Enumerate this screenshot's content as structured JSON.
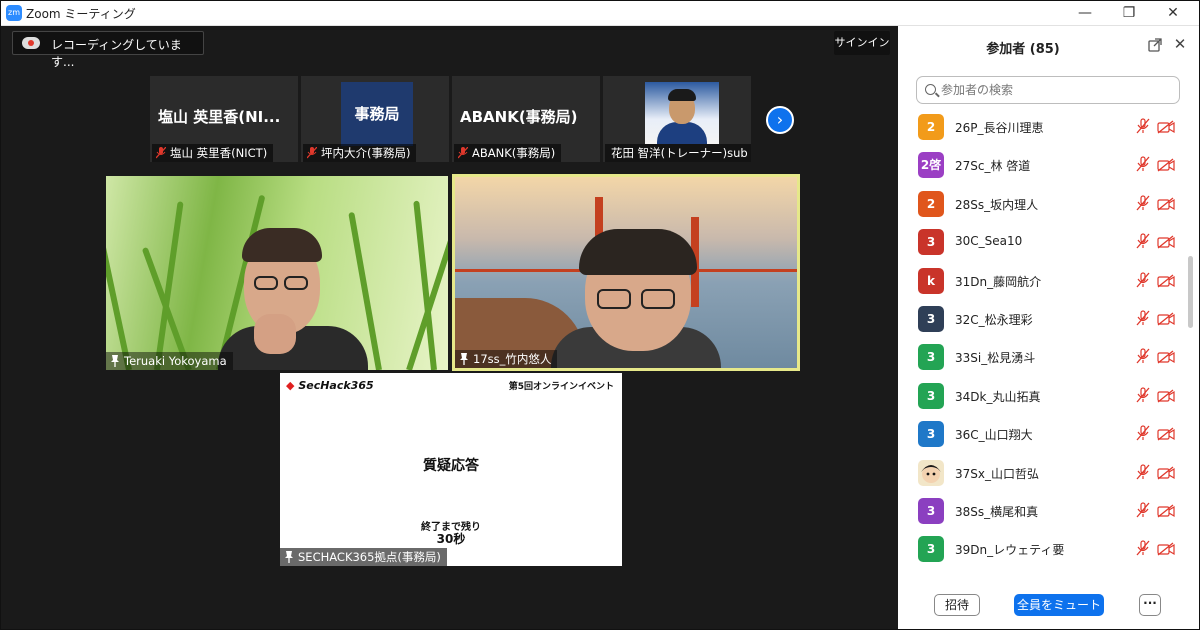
{
  "window": {
    "app_icon_text": "zm",
    "title": "Zoom ミーティング",
    "minimize": "—",
    "maximize": "❐",
    "close": "✕"
  },
  "meeting": {
    "recording_text": "レコーディングしています...",
    "signin_label": "サインイン",
    "top_strip": [
      {
        "big_text": "塩山 英里香(NI...",
        "label": "塩山 英里香(NICT)"
      },
      {
        "big_text": "事務局",
        "label": "坪内大介(事務局)"
      },
      {
        "big_text": "ABANK(事務局)",
        "label": "ABANK(事務局)"
      },
      {
        "big_text": "",
        "label": "花田 智洋(トレーナー)sub"
      }
    ],
    "next_icon": "›",
    "video_left_label": "Teruaki Yokoyama",
    "video_right_label": "17ss_竹内悠人",
    "slide": {
      "logo": "SecHack365",
      "event": "第5回オンラインイベント",
      "title": "質疑応答",
      "remaining": "終了まで残り",
      "seconds": "30秒",
      "label": "SECHACK365拠点(事務局)"
    }
  },
  "panel": {
    "title": "参加者 (85)",
    "search_placeholder": "参加者の検索",
    "close_icon": "✕",
    "participants": [
      {
        "avatar": "2",
        "color": "#f29b1a",
        "name": "26P_長谷川理恵"
      },
      {
        "avatar": "2啓",
        "color": "#9b3fc4",
        "name": "27Sc_林 啓道"
      },
      {
        "avatar": "2",
        "color": "#e0561c",
        "name": "28Ss_坂内理人"
      },
      {
        "avatar": "3",
        "color": "#c9342a",
        "name": "30C_Sea10"
      },
      {
        "avatar": "k",
        "color": "#c9342a",
        "name": "31Dn_藤岡航介"
      },
      {
        "avatar": "3",
        "color": "#2f3f57",
        "name": "32C_松永理彩"
      },
      {
        "avatar": "3",
        "color": "#23a454",
        "name": "33Si_松見湧斗"
      },
      {
        "avatar": "3",
        "color": "#23a454",
        "name": "34Dk_丸山拓真"
      },
      {
        "avatar": "3",
        "color": "#1f78c8",
        "name": "36C_山口翔大"
      },
      {
        "avatar": "",
        "color": "#f2e6c8",
        "name": "37Sx_山口哲弘"
      },
      {
        "avatar": "3",
        "color": "#8b3fc0",
        "name": "38Ss_横尾和真"
      },
      {
        "avatar": "3",
        "color": "#23a454",
        "name": "39Dn_レウェティ要"
      }
    ],
    "invite_label": "招待",
    "mute_all_label": "全員をミュート",
    "more_label": "···"
  }
}
